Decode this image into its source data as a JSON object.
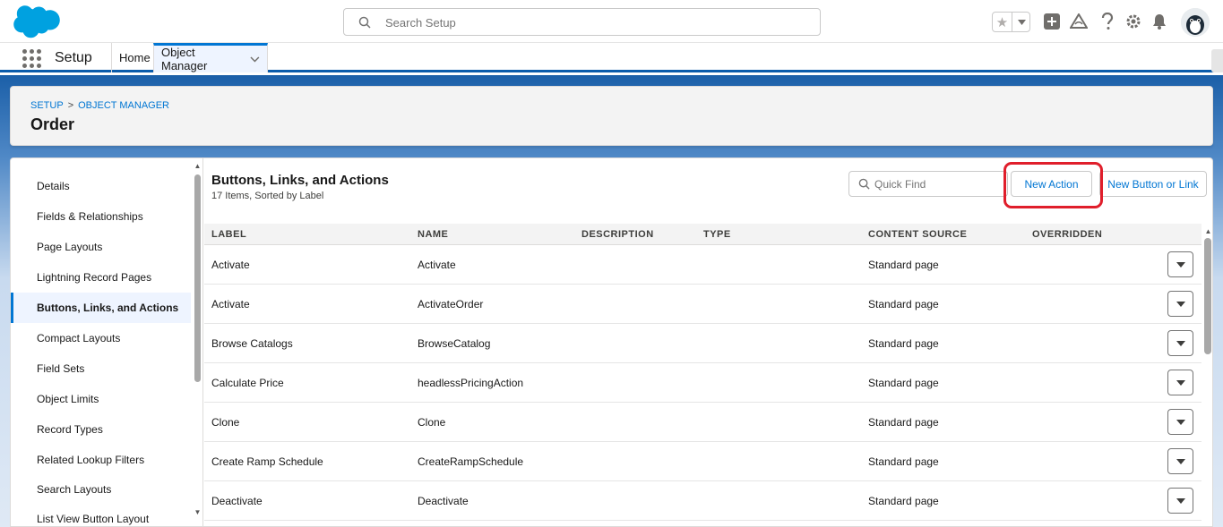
{
  "header": {
    "search_placeholder": "Search Setup",
    "avatar_icon": "user-avatar-icon",
    "icons": [
      "favorites-star-icon",
      "chevron-down-icon",
      "add-icon",
      "trailhead-icon",
      "help-icon",
      "gear-icon",
      "bell-icon"
    ]
  },
  "nav": {
    "app_name": "Setup",
    "tabs": [
      {
        "label": "Home"
      },
      {
        "label": "Object Manager"
      }
    ]
  },
  "page_header": {
    "breadcrumb": [
      "SETUP",
      "OBJECT MANAGER"
    ],
    "breadcrumb_sep": ">",
    "title": "Order"
  },
  "sidebar": {
    "items": [
      {
        "label": "Details"
      },
      {
        "label": "Fields & Relationships"
      },
      {
        "label": "Page Layouts"
      },
      {
        "label": "Lightning Record Pages"
      },
      {
        "label": "Buttons, Links, and Actions",
        "active": true
      },
      {
        "label": "Compact Layouts"
      },
      {
        "label": "Field Sets"
      },
      {
        "label": "Object Limits"
      },
      {
        "label": "Record Types"
      },
      {
        "label": "Related Lookup Filters"
      },
      {
        "label": "Search Layouts"
      },
      {
        "label": "List View Button Layout"
      }
    ]
  },
  "content": {
    "title": "Buttons, Links, and Actions",
    "subtitle": "17 Items, Sorted by Label",
    "quick_find_placeholder": "Quick Find",
    "new_action_label": "New Action",
    "new_button_label": "New Button or Link",
    "highlight_color": "#e01e2b",
    "columns": [
      "LABEL",
      "NAME",
      "DESCRIPTION",
      "TYPE",
      "CONTENT SOURCE",
      "OVERRIDDEN"
    ],
    "rows": [
      {
        "label": "Activate",
        "name": "Activate",
        "description": "",
        "type": "",
        "content_source": "Standard page",
        "overridden": ""
      },
      {
        "label": "Activate",
        "name": "ActivateOrder",
        "description": "",
        "type": "",
        "content_source": "Standard page",
        "overridden": ""
      },
      {
        "label": "Browse Catalogs",
        "name": "BrowseCatalog",
        "description": "",
        "type": "",
        "content_source": "Standard page",
        "overridden": ""
      },
      {
        "label": "Calculate Price",
        "name": "headlessPricingAction",
        "description": "",
        "type": "",
        "content_source": "Standard page",
        "overridden": ""
      },
      {
        "label": "Clone",
        "name": "Clone",
        "description": "",
        "type": "",
        "content_source": "Standard page",
        "overridden": ""
      },
      {
        "label": "Create Ramp Schedule",
        "name": "CreateRampSchedule",
        "description": "",
        "type": "",
        "content_source": "Standard page",
        "overridden": ""
      },
      {
        "label": "Deactivate",
        "name": "Deactivate",
        "description": "",
        "type": "",
        "content_source": "Standard page",
        "overridden": ""
      }
    ]
  },
  "colors": {
    "brand_blue": "#0176d3",
    "header_blue": "#0b5cab"
  }
}
